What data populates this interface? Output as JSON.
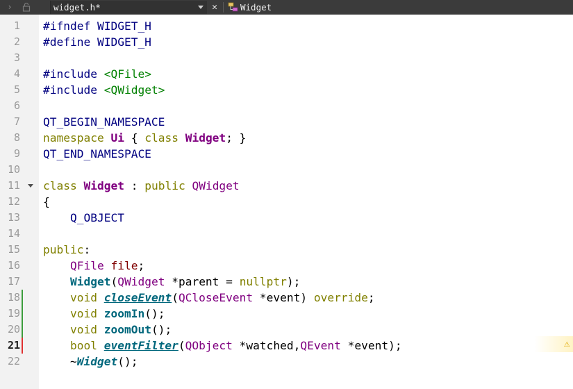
{
  "toolbar": {
    "file_name": "widget.h*",
    "close_glyph": "✕",
    "symbol_name": "Widget",
    "back_icon": "chevron-right-icon",
    "lock_icon": "lock-icon"
  },
  "editor": {
    "current_line": 21,
    "lines": [
      {
        "n": "1",
        "tokens": [
          {
            "c": "pp",
            "t": "#ifndef WIDGET_H"
          }
        ]
      },
      {
        "n": "2",
        "tokens": [
          {
            "c": "pp",
            "t": "#define WIDGET_H"
          }
        ]
      },
      {
        "n": "3",
        "tokens": []
      },
      {
        "n": "4",
        "tokens": [
          {
            "c": "pp",
            "t": "#include "
          },
          {
            "c": "str",
            "t": "<QFile>"
          }
        ]
      },
      {
        "n": "5",
        "tokens": [
          {
            "c": "pp",
            "t": "#include "
          },
          {
            "c": "str",
            "t": "<QWidget>"
          }
        ]
      },
      {
        "n": "6",
        "tokens": []
      },
      {
        "n": "7",
        "tokens": [
          {
            "c": "mac",
            "t": "QT_BEGIN_NAMESPACE"
          }
        ]
      },
      {
        "n": "8",
        "tokens": [
          {
            "c": "kw",
            "t": "namespace "
          },
          {
            "c": "ty bold",
            "t": "Ui"
          },
          {
            "c": "",
            "t": " { "
          },
          {
            "c": "kw",
            "t": "class "
          },
          {
            "c": "ty bold",
            "t": "Widget"
          },
          {
            "c": "",
            "t": "; }"
          }
        ]
      },
      {
        "n": "9",
        "tokens": [
          {
            "c": "mac",
            "t": "QT_END_NAMESPACE"
          }
        ]
      },
      {
        "n": "10",
        "tokens": []
      },
      {
        "n": "11",
        "fold": true,
        "tokens": [
          {
            "c": "kw",
            "t": "class "
          },
          {
            "c": "ty bold",
            "t": "Widget"
          },
          {
            "c": "",
            "t": " : "
          },
          {
            "c": "kw",
            "t": "public "
          },
          {
            "c": "ty",
            "t": "QWidget"
          }
        ]
      },
      {
        "n": "12",
        "tokens": [
          {
            "c": "",
            "t": "{"
          }
        ]
      },
      {
        "n": "13",
        "tokens": [
          {
            "c": "",
            "t": "    "
          },
          {
            "c": "mac",
            "t": "Q_OBJECT"
          }
        ]
      },
      {
        "n": "14",
        "tokens": []
      },
      {
        "n": "15",
        "tokens": [
          {
            "c": "kw",
            "t": "public"
          },
          {
            "c": "",
            "t": ":"
          }
        ]
      },
      {
        "n": "16",
        "tokens": [
          {
            "c": "",
            "t": "    "
          },
          {
            "c": "ty",
            "t": "QFile"
          },
          {
            "c": "",
            "t": " "
          },
          {
            "c": "var",
            "t": "file"
          },
          {
            "c": "",
            "t": ";"
          }
        ]
      },
      {
        "n": "17",
        "tokens": [
          {
            "c": "",
            "t": "    "
          },
          {
            "c": "fn",
            "t": "Widget"
          },
          {
            "c": "",
            "t": "("
          },
          {
            "c": "ty",
            "t": "QWidget"
          },
          {
            "c": "",
            "t": " *"
          },
          {
            "c": "",
            "t": "parent"
          },
          {
            "c": "",
            "t": " = "
          },
          {
            "c": "kw",
            "t": "nullptr"
          },
          {
            "c": "",
            "t": ");"
          }
        ]
      },
      {
        "n": "18",
        "mark": "green",
        "tokens": [
          {
            "c": "",
            "t": "    "
          },
          {
            "c": "kw",
            "t": "void "
          },
          {
            "c": "fnu",
            "t": "closeEvent"
          },
          {
            "c": "",
            "t": "("
          },
          {
            "c": "ty",
            "t": "QCloseEvent"
          },
          {
            "c": "",
            "t": " *event) "
          },
          {
            "c": "kw",
            "t": "override"
          },
          {
            "c": "",
            "t": ";"
          }
        ]
      },
      {
        "n": "19",
        "mark": "green",
        "tokens": [
          {
            "c": "",
            "t": "    "
          },
          {
            "c": "kw",
            "t": "void "
          },
          {
            "c": "fn",
            "t": "zoomIn"
          },
          {
            "c": "",
            "t": "();"
          }
        ]
      },
      {
        "n": "20",
        "mark": "green",
        "tokens": [
          {
            "c": "",
            "t": "    "
          },
          {
            "c": "kw",
            "t": "void "
          },
          {
            "c": "fn",
            "t": "zoomOut"
          },
          {
            "c": "",
            "t": "();"
          }
        ]
      },
      {
        "n": "21",
        "mark": "red",
        "tokens": [
          {
            "c": "",
            "t": "    "
          },
          {
            "c": "kw",
            "t": "bool "
          },
          {
            "c": "fnu",
            "t": "eventFilter"
          },
          {
            "c": "",
            "t": "("
          },
          {
            "c": "ty",
            "t": "QObject"
          },
          {
            "c": "",
            "t": " *watched,"
          },
          {
            "c": "ty",
            "t": "QEvent"
          },
          {
            "c": "",
            "t": " *event);"
          }
        ]
      },
      {
        "n": "22",
        "tokens": [
          {
            "c": "",
            "t": "    ~"
          },
          {
            "c": "fnv",
            "t": "Widget"
          },
          {
            "c": "",
            "t": "();"
          }
        ]
      }
    ]
  },
  "warning_icon": "warning-icon",
  "colors": {
    "toolbar_bg": "#3b3b3b",
    "gutter_bg": "#f2f2f2",
    "added_mark": "#3c9d3c",
    "modified_mark": "#e03030"
  }
}
